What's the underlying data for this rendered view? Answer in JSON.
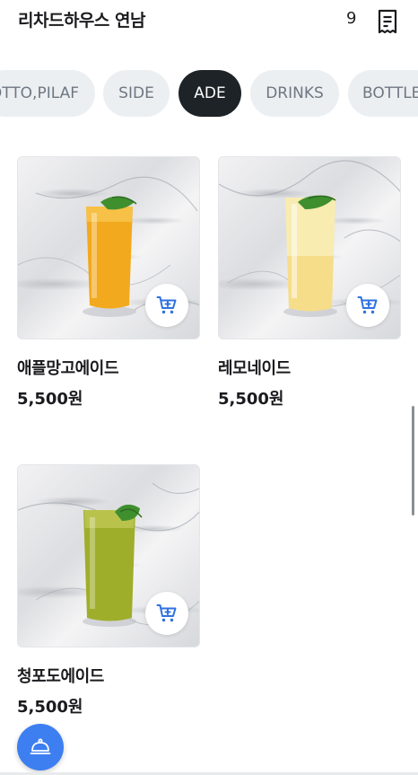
{
  "header": {
    "store_name": "리차드하우스 연남",
    "table_number": "9",
    "receipt_icon": "receipt-icon"
  },
  "tabs": [
    {
      "label": "RISOTTO,PILAF",
      "visible_text": "OTTO,PILAF",
      "active": false
    },
    {
      "label": "SIDE",
      "active": false
    },
    {
      "label": "ADE",
      "active": true
    },
    {
      "label": "DRINKS",
      "active": false
    },
    {
      "label": "BOTTLE",
      "visible_text": "BOTTLE",
      "active": false
    }
  ],
  "colors": {
    "accent": "#3d7ff0",
    "active_tab_bg": "#1d2327",
    "tab_bg": "#eceff2",
    "cart_icon": "#2f72e0"
  },
  "products": [
    {
      "name": "애플망고에이드",
      "price": "5,500원",
      "drink_color": "#f2a91d",
      "cart_icon": "cart-add-icon"
    },
    {
      "name": "레모네이드",
      "price": "5,500원",
      "drink_color": "#f8ecb0",
      "cart_icon": "cart-add-icon"
    },
    {
      "name": "청포도에이드",
      "price": "5,500원",
      "drink_color": "#9fae2a",
      "cart_icon": "cart-add-icon"
    }
  ],
  "fab": {
    "icon": "serving-cloche-icon"
  }
}
